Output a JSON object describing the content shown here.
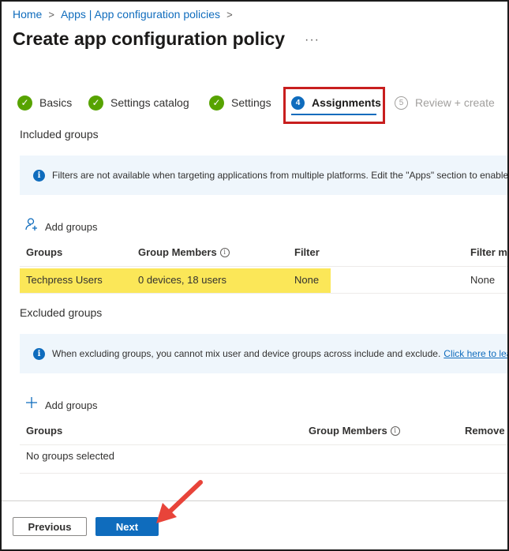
{
  "breadcrumb": {
    "home": "Home",
    "apps": "Apps | App configuration policies"
  },
  "page": {
    "title": "Create app configuration policy",
    "more": "···"
  },
  "steps": [
    {
      "label": "Basics",
      "state": "done"
    },
    {
      "label": "Settings catalog",
      "state": "done"
    },
    {
      "label": "Settings",
      "state": "done"
    },
    {
      "label": "Assignments",
      "state": "active",
      "number": "4"
    },
    {
      "label": "Review + create",
      "state": "disabled",
      "number": "5"
    }
  ],
  "included": {
    "section_label": "Included groups",
    "info_text": "Filters are not available when targeting applications from multiple platforms. Edit the \"Apps\" section to enable",
    "add_groups": "Add groups",
    "headers": {
      "groups": "Groups",
      "group_members": "Group Members",
      "filter": "Filter",
      "filter_mode": "Filter mo"
    },
    "row": {
      "group": "Techpress Users",
      "members": "0 devices, 18 users",
      "filter": "None",
      "filter_mode": "None"
    }
  },
  "excluded": {
    "section_label": "Excluded groups",
    "info_text": "When excluding groups, you cannot mix user and device groups across include and exclude.",
    "info_link": "Click here to lear",
    "add_groups": "Add groups",
    "headers": {
      "groups": "Groups",
      "group_members": "Group Members",
      "remove": "Remove"
    },
    "empty": "No groups selected"
  },
  "footer": {
    "previous": "Previous",
    "next": "Next"
  },
  "colors": {
    "accent": "#0f6cbd",
    "success": "#57a300",
    "highlight": "#fbe758",
    "annotation": "#c81e1e",
    "info_bg": "#eff6fc"
  },
  "icons": {
    "step_done": "checkmark-circle-icon",
    "info": "info-icon",
    "add_user": "add-person-icon",
    "add": "plus-icon"
  }
}
